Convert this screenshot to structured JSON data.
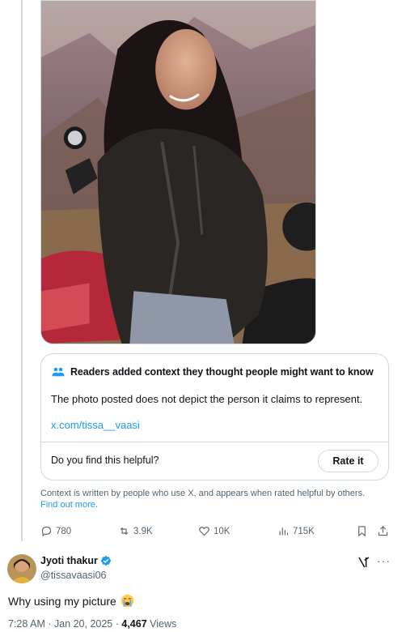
{
  "note": {
    "title": "Readers added context they thought people might want to know",
    "text": "The photo posted does not depict the person it claims to represent.",
    "link": "x.com/tissa__vaasi",
    "question": "Do you find this helpful?",
    "rate_label": "Rate it"
  },
  "context": {
    "text": "Context is written by people who use X, and appears when rated helpful by others.",
    "link": "Find out more."
  },
  "actions": {
    "replies": "780",
    "reposts": "3.9K",
    "likes": "10K",
    "views": "715K"
  },
  "reply": {
    "name": "Jyoti thakur",
    "handle": "@tissavaasi06",
    "text": "Why using my picture",
    "time": "7:28 AM · Jan 20, 2025 · ",
    "views_count": "4,467",
    "views_label": " Views"
  },
  "colors": {
    "accent": "#1d9bf0",
    "muted": "#536471",
    "border": "#cfd9de",
    "verified": "#1d9bf0"
  },
  "icons": [
    "reply-icon",
    "repost-icon",
    "like-icon",
    "views-icon",
    "bookmark-icon",
    "share-icon",
    "community-notes-icon",
    "verified-icon",
    "grok-icon",
    "more-icon",
    "crying-emoji"
  ]
}
